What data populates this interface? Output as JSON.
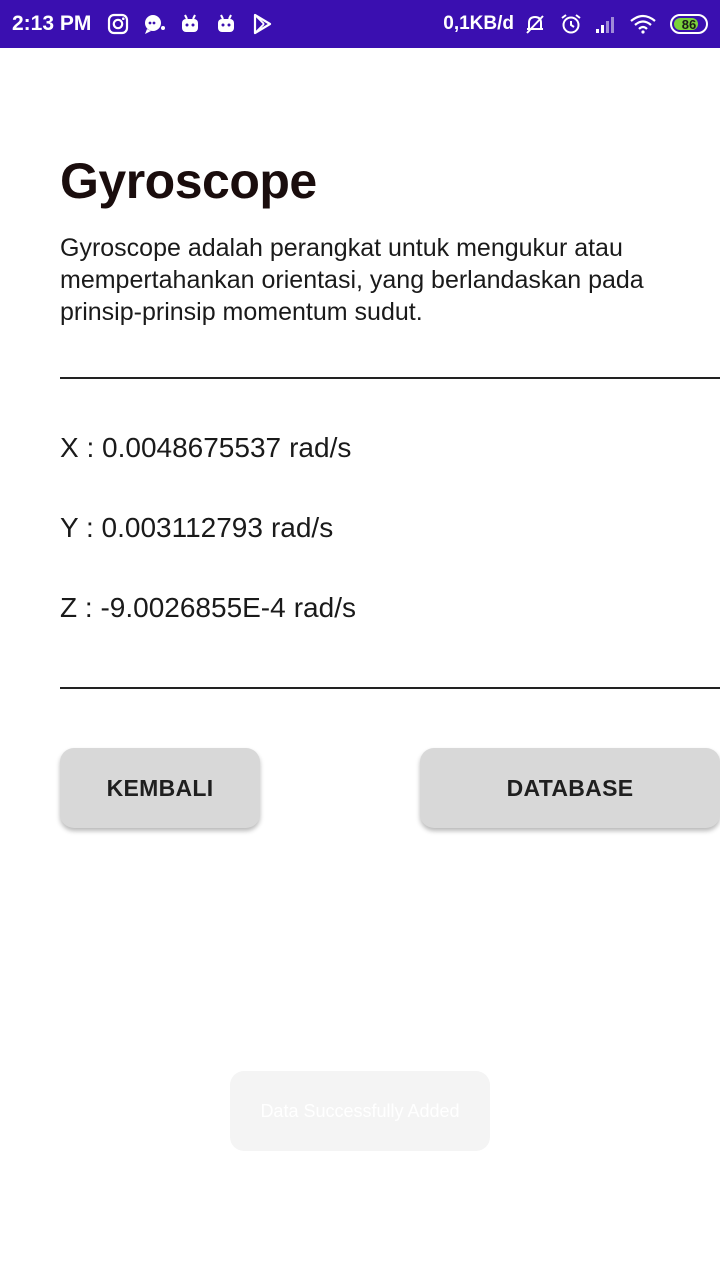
{
  "status_bar": {
    "time": "2:13 PM",
    "network_speed": "0,1KB/d",
    "battery_level": "86",
    "background_color": "#3a0fb0",
    "left_icons": [
      "instagram-icon",
      "chat-bubble-icon",
      "android-icon",
      "android-icon",
      "play-store-icon"
    ],
    "right_icons": [
      "bell-muted-icon",
      "alarm-icon",
      "signal-icon",
      "wifi-icon",
      "battery-icon"
    ]
  },
  "main": {
    "title": "Gyroscope",
    "description": "Gyroscope adalah perangkat untuk mengukur atau mempertahankan orientasi, yang berlandaskan pada prinsip-prinsip momentum sudut."
  },
  "readings": {
    "x": {
      "label": "X :",
      "value": "0.0048675537",
      "unit": "rad/s"
    },
    "y": {
      "label": "Y :",
      "value": "0.003112793",
      "unit": "rad/s"
    },
    "z": {
      "label": "Z :",
      "value": "-9.0026855E-4",
      "unit": "rad/s"
    }
  },
  "buttons": {
    "back_label": "KEMBALI",
    "database_label": "DATABASE"
  },
  "toast": {
    "message": "Data Successfully Added"
  }
}
